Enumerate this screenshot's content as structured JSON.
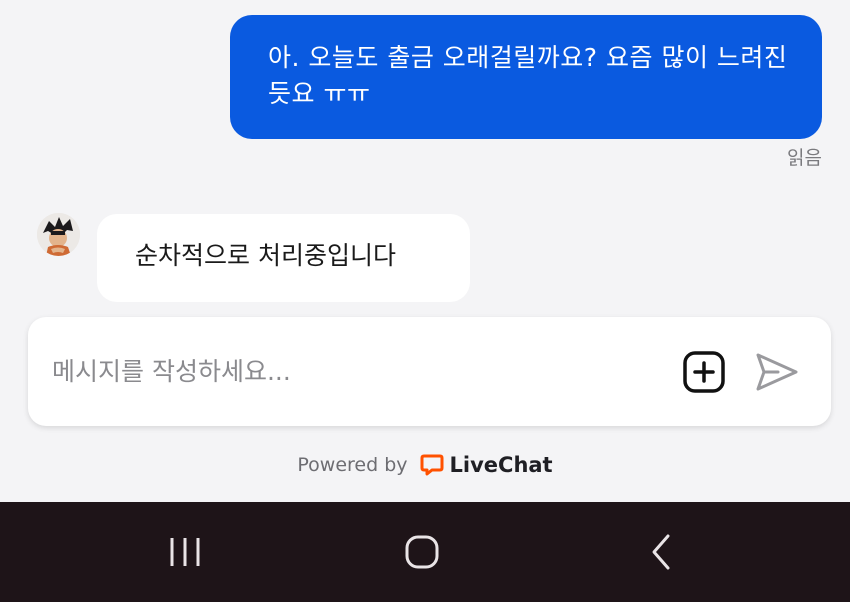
{
  "chat": {
    "outgoing_message": "아. 오늘도 출금 오래걸릴까요? 요즘 많이 느려진듯요 ㅠㅠ",
    "read_status": "읽음",
    "incoming_message": "순차적으로 처리중입니다"
  },
  "composer": {
    "placeholder": "메시지를 작성하세요...",
    "value": "",
    "attach_icon": "plus-square-icon",
    "send_icon": "send-icon"
  },
  "footer": {
    "powered_by": "Powered by",
    "brand_name": "LiveChat",
    "brand_icon": "livechat-logo-icon"
  },
  "navigation": {
    "recents_icon": "recents-icon",
    "home_icon": "home-icon",
    "back_icon": "back-icon"
  },
  "colors": {
    "outgoing_bubble": "#0a5ae0",
    "incoming_bubble": "#ffffff",
    "background": "#f4f4f6",
    "brand_accent": "#ff5100",
    "navbar": "#1e1418"
  }
}
